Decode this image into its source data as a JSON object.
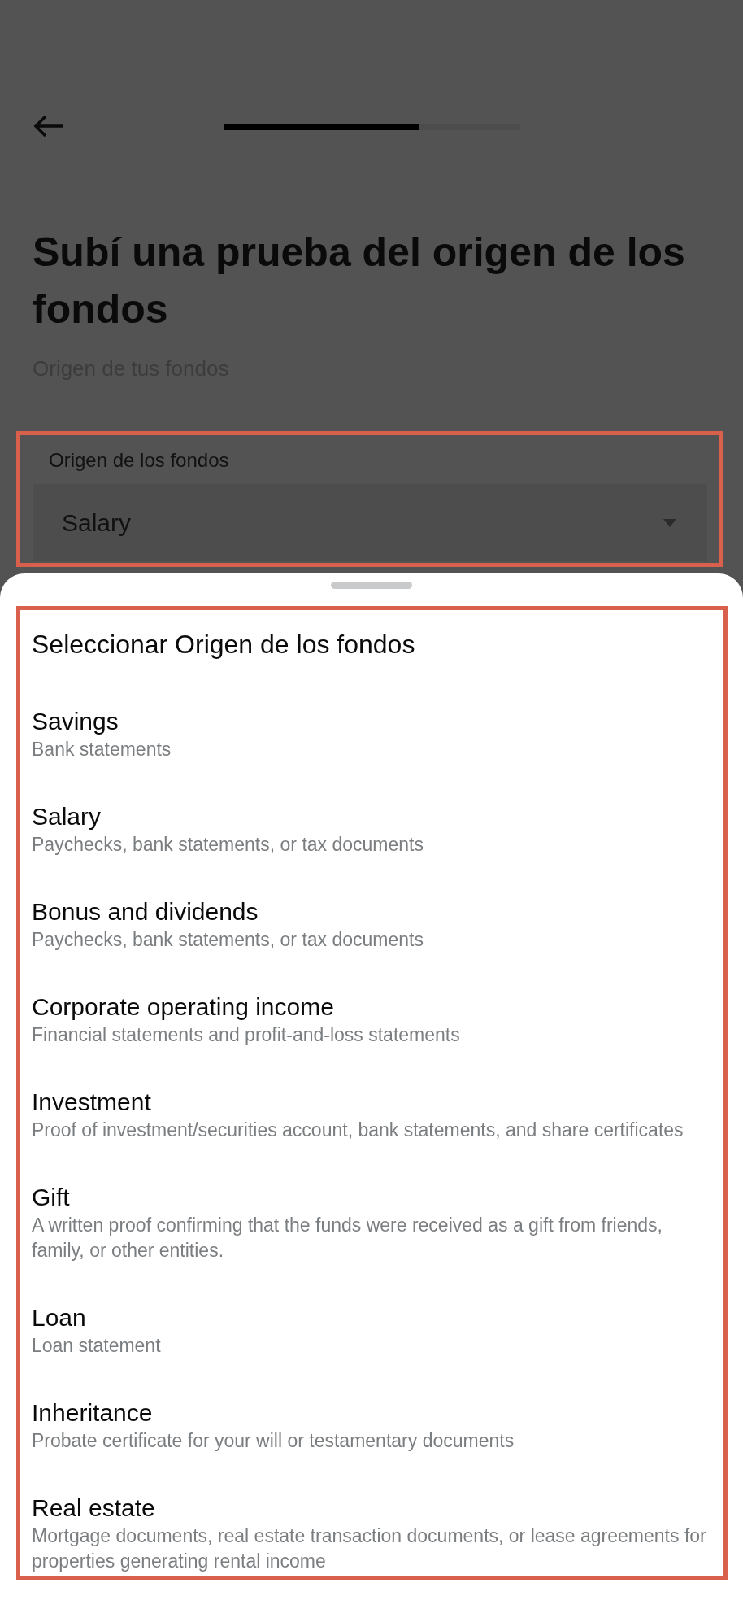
{
  "progress": {
    "level": 0.66
  },
  "title": "Subí una prueba del origen de los fondos",
  "subtitle": "Origen de tus fondos",
  "field": {
    "label": "Origen de los fondos",
    "value": "Salary"
  },
  "sheet": {
    "title": "Seleccionar Origen de los fondos",
    "options": [
      {
        "title": "Savings",
        "description": "Bank statements"
      },
      {
        "title": "Salary",
        "description": "Paychecks, bank statements, or tax documents"
      },
      {
        "title": "Bonus and dividends",
        "description": "Paychecks, bank statements, or tax documents"
      },
      {
        "title": "Corporate operating income",
        "description": "Financial statements and profit-and-loss statements"
      },
      {
        "title": "Investment",
        "description": "Proof of investment/securities account, bank statements, and share certificates"
      },
      {
        "title": "Gift",
        "description": "A written proof confirming that the funds were received as a gift from friends, family, or other entities."
      },
      {
        "title": "Loan",
        "description": "Loan statement"
      },
      {
        "title": "Inheritance",
        "description": "Probate certificate for your will or testamentary documents"
      },
      {
        "title": "Real estate",
        "description": "Mortgage documents, real estate transaction documents, or lease agreements for properties generating rental income"
      }
    ]
  }
}
